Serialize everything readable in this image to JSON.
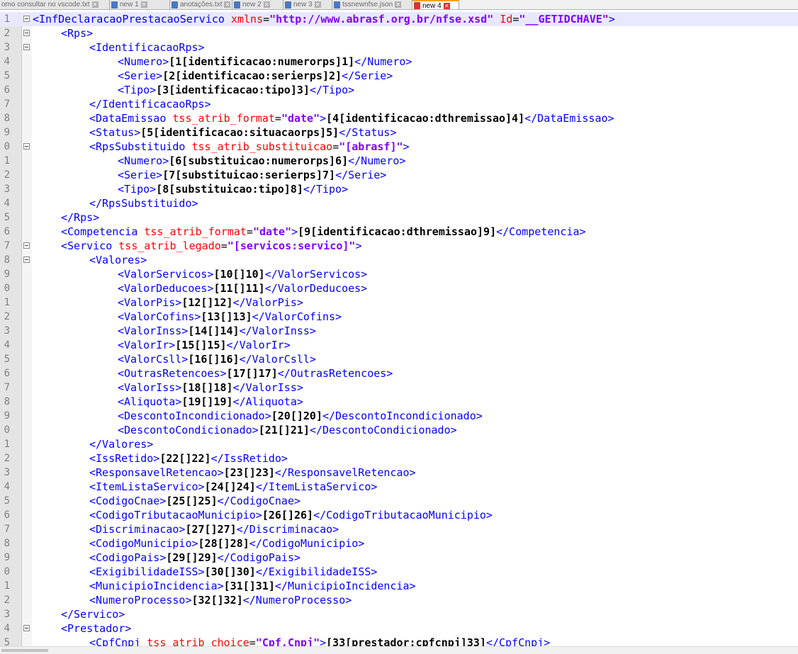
{
  "tabs": [
    {
      "label": "omo consultar no vscode.txt",
      "icon": "saved-file-icon",
      "active": false
    },
    {
      "label": "new 1",
      "icon": "saved-file-icon",
      "active": false
    },
    {
      "label": "anotações.txt",
      "icon": "saved-file-icon",
      "active": false
    },
    {
      "label": "new 2",
      "icon": "saved-file-icon",
      "active": false
    },
    {
      "label": "new 3",
      "icon": "saved-file-icon",
      "active": false
    },
    {
      "label": "tssnewnfse.json",
      "icon": "saved-file-icon",
      "active": false
    },
    {
      "label": "new 4",
      "icon": "unsaved-file-icon",
      "active": true
    }
  ],
  "lines": [
    {
      "n": "1",
      "fold": true,
      "indent": 0,
      "tok": [
        [
          "t",
          "<InfDeclaracaoPrestacaoServico "
        ],
        [
          "a",
          "xmlns"
        ],
        [
          "e",
          "="
        ],
        [
          "v",
          "\"http://www.abrasf.org.br/nfse.xsd\""
        ],
        [
          "a",
          " Id"
        ],
        [
          "e",
          "="
        ],
        [
          "v",
          "\"__GETIDCHAVE\""
        ],
        [
          "t",
          ">"
        ]
      ]
    },
    {
      "n": "2",
      "fold": true,
      "indent": 1,
      "tok": [
        [
          "t",
          "<Rps>"
        ]
      ]
    },
    {
      "n": "3",
      "fold": true,
      "indent": 2,
      "tok": [
        [
          "t",
          "<IdentificacaoRps>"
        ]
      ]
    },
    {
      "n": "4",
      "fold": false,
      "indent": 3,
      "tok": [
        [
          "t",
          "<Numero>"
        ],
        [
          "x",
          "[1[identificacao:numerorps]1]"
        ],
        [
          "t",
          "</Numero>"
        ]
      ]
    },
    {
      "n": "5",
      "fold": false,
      "indent": 3,
      "tok": [
        [
          "t",
          "<Serie>"
        ],
        [
          "x",
          "[2[identificacao:serierps]2]"
        ],
        [
          "t",
          "</Serie>"
        ]
      ]
    },
    {
      "n": "6",
      "fold": false,
      "indent": 3,
      "tok": [
        [
          "t",
          "<Tipo>"
        ],
        [
          "x",
          "[3[identificacao:tipo]3]"
        ],
        [
          "t",
          "</Tipo>"
        ]
      ]
    },
    {
      "n": "7",
      "fold": false,
      "indent": 2,
      "tok": [
        [
          "t",
          "</IdentificacaoRps>"
        ]
      ]
    },
    {
      "n": "8",
      "fold": false,
      "indent": 2,
      "tok": [
        [
          "t",
          "<DataEmissao "
        ],
        [
          "a",
          "tss_atrib_format"
        ],
        [
          "e",
          "="
        ],
        [
          "v",
          "\"date\""
        ],
        [
          "t",
          ">"
        ],
        [
          "x",
          "[4[identificacao:dthremissao]4]"
        ],
        [
          "t",
          "</DataEmissao>"
        ]
      ]
    },
    {
      "n": "9",
      "fold": false,
      "indent": 2,
      "tok": [
        [
          "t",
          "<Status>"
        ],
        [
          "x",
          "[5[identificacao:situacaorps]5]"
        ],
        [
          "t",
          "</Status>"
        ]
      ]
    },
    {
      "n": "0",
      "fold": true,
      "indent": 2,
      "tok": [
        [
          "t",
          "<RpsSubstituido "
        ],
        [
          "a",
          "tss_atrib_substituicao"
        ],
        [
          "e",
          "="
        ],
        [
          "v",
          "\"[abrasf]\""
        ],
        [
          "t",
          ">"
        ]
      ]
    },
    {
      "n": "1",
      "fold": false,
      "indent": 3,
      "tok": [
        [
          "t",
          "<Numero>"
        ],
        [
          "x",
          "[6[substituicao:numerorps]6]"
        ],
        [
          "t",
          "</Numero>"
        ]
      ]
    },
    {
      "n": "2",
      "fold": false,
      "indent": 3,
      "tok": [
        [
          "t",
          "<Serie>"
        ],
        [
          "x",
          "[7[substituicao:serierps]7]"
        ],
        [
          "t",
          "</Serie>"
        ]
      ]
    },
    {
      "n": "3",
      "fold": false,
      "indent": 3,
      "tok": [
        [
          "t",
          "<Tipo>"
        ],
        [
          "x",
          "[8[substituicao:tipo]8]"
        ],
        [
          "t",
          "</Tipo>"
        ]
      ]
    },
    {
      "n": "4",
      "fold": false,
      "indent": 2,
      "tok": [
        [
          "t",
          "</RpsSubstituido>"
        ]
      ]
    },
    {
      "n": "5",
      "fold": false,
      "indent": 1,
      "tok": [
        [
          "t",
          "</Rps>"
        ]
      ]
    },
    {
      "n": "6",
      "fold": false,
      "indent": 1,
      "tok": [
        [
          "t",
          "<Competencia "
        ],
        [
          "a",
          "tss_atrib_format"
        ],
        [
          "e",
          "="
        ],
        [
          "v",
          "\"date\""
        ],
        [
          "t",
          ">"
        ],
        [
          "x",
          "[9[identificacao:dthremissao]9]"
        ],
        [
          "t",
          "</Competencia>"
        ]
      ]
    },
    {
      "n": "7",
      "fold": true,
      "indent": 1,
      "tok": [
        [
          "t",
          "<Servico "
        ],
        [
          "a",
          "tss_atrib_legado"
        ],
        [
          "e",
          "="
        ],
        [
          "v",
          "\"[servicos:servico]\""
        ],
        [
          "t",
          ">"
        ]
      ]
    },
    {
      "n": "8",
      "fold": true,
      "indent": 2,
      "tok": [
        [
          "t",
          "<Valores>"
        ]
      ]
    },
    {
      "n": "9",
      "fold": false,
      "indent": 3,
      "tok": [
        [
          "t",
          "<ValorServicos>"
        ],
        [
          "x",
          "[10[]10]"
        ],
        [
          "t",
          "</ValorServicos>"
        ]
      ]
    },
    {
      "n": "0",
      "fold": false,
      "indent": 3,
      "tok": [
        [
          "t",
          "<ValorDeducoes>"
        ],
        [
          "x",
          "[11[]11]"
        ],
        [
          "t",
          "</ValorDeducoes>"
        ]
      ]
    },
    {
      "n": "1",
      "fold": false,
      "indent": 3,
      "tok": [
        [
          "t",
          "<ValorPis>"
        ],
        [
          "x",
          "[12[]12]"
        ],
        [
          "t",
          "</ValorPis>"
        ]
      ]
    },
    {
      "n": "2",
      "fold": false,
      "indent": 3,
      "tok": [
        [
          "t",
          "<ValorCofins>"
        ],
        [
          "x",
          "[13[]13]"
        ],
        [
          "t",
          "</ValorCofins>"
        ]
      ]
    },
    {
      "n": "3",
      "fold": false,
      "indent": 3,
      "tok": [
        [
          "t",
          "<ValorInss>"
        ],
        [
          "x",
          "[14[]14]"
        ],
        [
          "t",
          "</ValorInss>"
        ]
      ]
    },
    {
      "n": "4",
      "fold": false,
      "indent": 3,
      "tok": [
        [
          "t",
          "<ValorIr>"
        ],
        [
          "x",
          "[15[]15]"
        ],
        [
          "t",
          "</ValorIr>"
        ]
      ]
    },
    {
      "n": "5",
      "fold": false,
      "indent": 3,
      "tok": [
        [
          "t",
          "<ValorCsll>"
        ],
        [
          "x",
          "[16[]16]"
        ],
        [
          "t",
          "</ValorCsll>"
        ]
      ]
    },
    {
      "n": "6",
      "fold": false,
      "indent": 3,
      "tok": [
        [
          "t",
          "<OutrasRetencoes>"
        ],
        [
          "x",
          "[17[]17]"
        ],
        [
          "t",
          "</OutrasRetencoes>"
        ]
      ]
    },
    {
      "n": "7",
      "fold": false,
      "indent": 3,
      "tok": [
        [
          "t",
          "<ValorIss>"
        ],
        [
          "x",
          "[18[]18]"
        ],
        [
          "t",
          "</ValorIss>"
        ]
      ]
    },
    {
      "n": "8",
      "fold": false,
      "indent": 3,
      "tok": [
        [
          "t",
          "<Aliquota>"
        ],
        [
          "x",
          "[19[]19]"
        ],
        [
          "t",
          "</Aliquota>"
        ]
      ]
    },
    {
      "n": "9",
      "fold": false,
      "indent": 3,
      "tok": [
        [
          "t",
          "<DescontoIncondicionado>"
        ],
        [
          "x",
          "[20[]20]"
        ],
        [
          "t",
          "</DescontoIncondicionado>"
        ]
      ]
    },
    {
      "n": "0",
      "fold": false,
      "indent": 3,
      "tok": [
        [
          "t",
          "<DescontoCondicionado>"
        ],
        [
          "x",
          "[21[]21]"
        ],
        [
          "t",
          "</DescontoCondicionado>"
        ]
      ]
    },
    {
      "n": "1",
      "fold": false,
      "indent": 2,
      "tok": [
        [
          "t",
          "</Valores>"
        ]
      ]
    },
    {
      "n": "2",
      "fold": false,
      "indent": 2,
      "tok": [
        [
          "t",
          "<IssRetido>"
        ],
        [
          "x",
          "[22[]22]"
        ],
        [
          "t",
          "</IssRetido>"
        ]
      ]
    },
    {
      "n": "3",
      "fold": false,
      "indent": 2,
      "tok": [
        [
          "t",
          "<ResponsavelRetencao>"
        ],
        [
          "x",
          "[23[]23]"
        ],
        [
          "t",
          "</ResponsavelRetencao>"
        ]
      ]
    },
    {
      "n": "4",
      "fold": false,
      "indent": 2,
      "tok": [
        [
          "t",
          "<ItemListaServico>"
        ],
        [
          "x",
          "[24[]24]"
        ],
        [
          "t",
          "</ItemListaServico>"
        ]
      ]
    },
    {
      "n": "5",
      "fold": false,
      "indent": 2,
      "tok": [
        [
          "t",
          "<CodigoCnae>"
        ],
        [
          "x",
          "[25[]25]"
        ],
        [
          "t",
          "</CodigoCnae>"
        ]
      ]
    },
    {
      "n": "6",
      "fold": false,
      "indent": 2,
      "tok": [
        [
          "t",
          "<CodigoTributacaoMunicipio>"
        ],
        [
          "x",
          "[26[]26]"
        ],
        [
          "t",
          "</CodigoTributacaoMunicipio>"
        ]
      ]
    },
    {
      "n": "7",
      "fold": false,
      "indent": 2,
      "tok": [
        [
          "t",
          "<Discriminacao>"
        ],
        [
          "x",
          "[27[]27]"
        ],
        [
          "t",
          "</Discriminacao>"
        ]
      ]
    },
    {
      "n": "8",
      "fold": false,
      "indent": 2,
      "tok": [
        [
          "t",
          "<CodigoMunicipio>"
        ],
        [
          "x",
          "[28[]28]"
        ],
        [
          "t",
          "</CodigoMunicipio>"
        ]
      ]
    },
    {
      "n": "9",
      "fold": false,
      "indent": 2,
      "tok": [
        [
          "t",
          "<CodigoPais>"
        ],
        [
          "x",
          "[29[]29]"
        ],
        [
          "t",
          "</CodigoPais>"
        ]
      ]
    },
    {
      "n": "0",
      "fold": false,
      "indent": 2,
      "tok": [
        [
          "t",
          "<ExigibilidadeISS>"
        ],
        [
          "x",
          "[30[]30]"
        ],
        [
          "t",
          "</ExigibilidadeISS>"
        ]
      ]
    },
    {
      "n": "1",
      "fold": false,
      "indent": 2,
      "tok": [
        [
          "t",
          "<MunicipioIncidencia>"
        ],
        [
          "x",
          "[31[]31]"
        ],
        [
          "t",
          "</MunicipioIncidencia>"
        ]
      ]
    },
    {
      "n": "2",
      "fold": false,
      "indent": 2,
      "tok": [
        [
          "t",
          "<NumeroProcesso>"
        ],
        [
          "x",
          "[32[]32]"
        ],
        [
          "t",
          "</NumeroProcesso>"
        ]
      ]
    },
    {
      "n": "3",
      "fold": false,
      "indent": 1,
      "tok": [
        [
          "t",
          "</Servico>"
        ]
      ]
    },
    {
      "n": "4",
      "fold": true,
      "indent": 1,
      "tok": [
        [
          "t",
          "<Prestador>"
        ]
      ]
    },
    {
      "n": "5",
      "fold": false,
      "indent": 2,
      "tok": [
        [
          "t",
          "<CpfCnpj "
        ],
        [
          "a",
          "tss_atrib_choice"
        ],
        [
          "e",
          "="
        ],
        [
          "v",
          "\"Cpf,Cnpj\""
        ],
        [
          "t",
          ">"
        ],
        [
          "x",
          "[33[prestador:cpfcnpj]33]"
        ],
        [
          "t",
          "</CpfCnpj>"
        ]
      ]
    }
  ]
}
